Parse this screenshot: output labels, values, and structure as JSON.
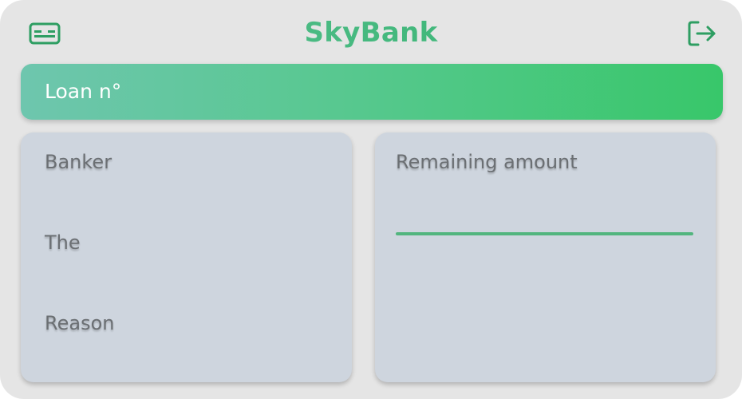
{
  "header": {
    "brand": "SkyBank",
    "left_icon": "id-card-icon",
    "right_icon": "logout-icon"
  },
  "loan": {
    "label": "Loan n°"
  },
  "details": {
    "banker_label": "Banker",
    "the_label": "The",
    "reason_label": "Reason"
  },
  "remaining": {
    "label": "Remaining amount",
    "progress_fraction": 1.0
  },
  "colors": {
    "brand_green": "#2fb36a",
    "accent_green": "#52b57e",
    "card_bg": "#ced5de",
    "app_bg": "#e5e5e5"
  }
}
